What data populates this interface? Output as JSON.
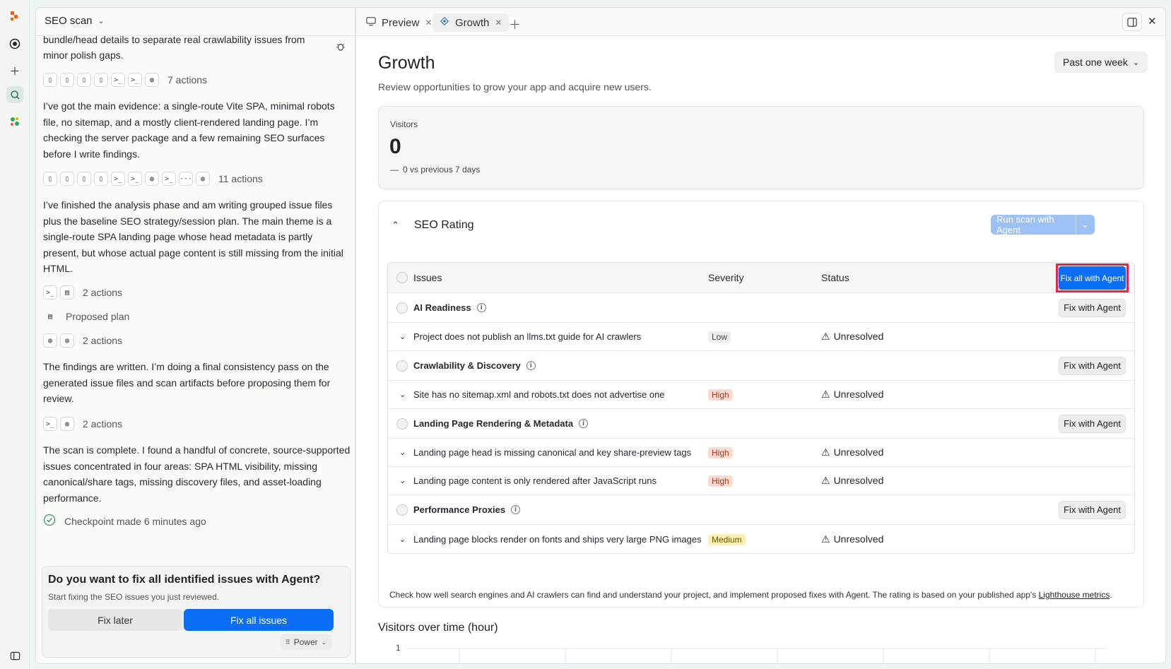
{
  "left_panel": {
    "title": "SEO scan",
    "truncated_text": "bundle/head details to separate real crawlability issues from minor polish gaps.",
    "action_group_1": "7 actions",
    "paragraph_1": "I’ve got the main evidence: a single-route Vite SPA, minimal robots file, no sitemap, and a mostly client-rendered landing page. I’m checking the server package and a few remaining SEO surfaces before I write findings.",
    "action_group_2": "11 actions",
    "paragraph_2": "I’ve finished the analysis phase and am writing grouped issue files plus the baseline SEO strategy/session plan. The main theme is a single-route SPA landing page whose head metadata is partly present, but whose actual page content is still missing from the initial HTML.",
    "action_group_3": "2 actions",
    "proposed_plan": "Proposed plan",
    "action_group_4": "2 actions",
    "paragraph_3": "The findings are written. I’m doing a final consistency pass on the generated issue files and scan artifacts before proposing them for review.",
    "action_group_5": "2 actions",
    "paragraph_4": "The scan is complete. I found a handful of concrete, source-supported issues concentrated in four areas: SPA HTML visibility, missing canonical/share tags, missing discovery files, and asset-loading performance.",
    "checkpoint": "Checkpoint made 6 minutes ago",
    "prompt_card": {
      "title": "Do you want to fix all identified issues with Agent?",
      "subtitle": "Start fixing the SEO issues you just reviewed.",
      "fix_later": "Fix later",
      "fix_all": "Fix all issues",
      "mode": "Power"
    }
  },
  "tabs": [
    {
      "label": "Preview"
    },
    {
      "label": "Growth"
    }
  ],
  "growth": {
    "title": "Growth",
    "subtitle": "Review opportunities to grow your app and acquire new users.",
    "range": "Past one week",
    "visitors": {
      "label": "Visitors",
      "value": "0",
      "delta": "0 vs previous 7 days"
    },
    "seo": {
      "title": "SEO Rating",
      "run_scan": "Run scan with Agent",
      "columns": {
        "issues": "Issues",
        "severity": "Severity",
        "status": "Status"
      },
      "fix_all": "Fix all with Agent",
      "fix_with_agent": "Fix with Agent",
      "groups": [
        {
          "name": "AI Readiness",
          "issues": [
            {
              "title": "Project does not publish an llms.txt guide for AI crawlers",
              "severity": "Low",
              "status": "Unresolved"
            }
          ]
        },
        {
          "name": "Crawlability & Discovery",
          "issues": [
            {
              "title": "Site has no sitemap.xml and robots.txt does not advertise one",
              "severity": "High",
              "status": "Unresolved"
            }
          ]
        },
        {
          "name": "Landing Page Rendering & Metadata",
          "issues": [
            {
              "title": "Landing page head is missing canonical and key share-preview tags",
              "severity": "High",
              "status": "Unresolved"
            },
            {
              "title": "Landing page content is only rendered after JavaScript runs",
              "severity": "High",
              "status": "Unresolved"
            }
          ]
        },
        {
          "name": "Performance Proxies",
          "issues": [
            {
              "title": "Landing page blocks render on fonts and ships very large PNG images",
              "severity": "Medium",
              "status": "Unresolved"
            }
          ]
        }
      ],
      "footer_text": "Check how well search engines and AI crawlers can find and understand your project, and implement proposed fixes with Agent. The rating is based on your published app's ",
      "footer_link": "Lighthouse metrics"
    },
    "chart": {
      "title": "Visitors over time (hour)",
      "y_tick": "1"
    }
  },
  "colors": {
    "accent": "#0b6ff5",
    "highlight_border": "#e2264d"
  }
}
